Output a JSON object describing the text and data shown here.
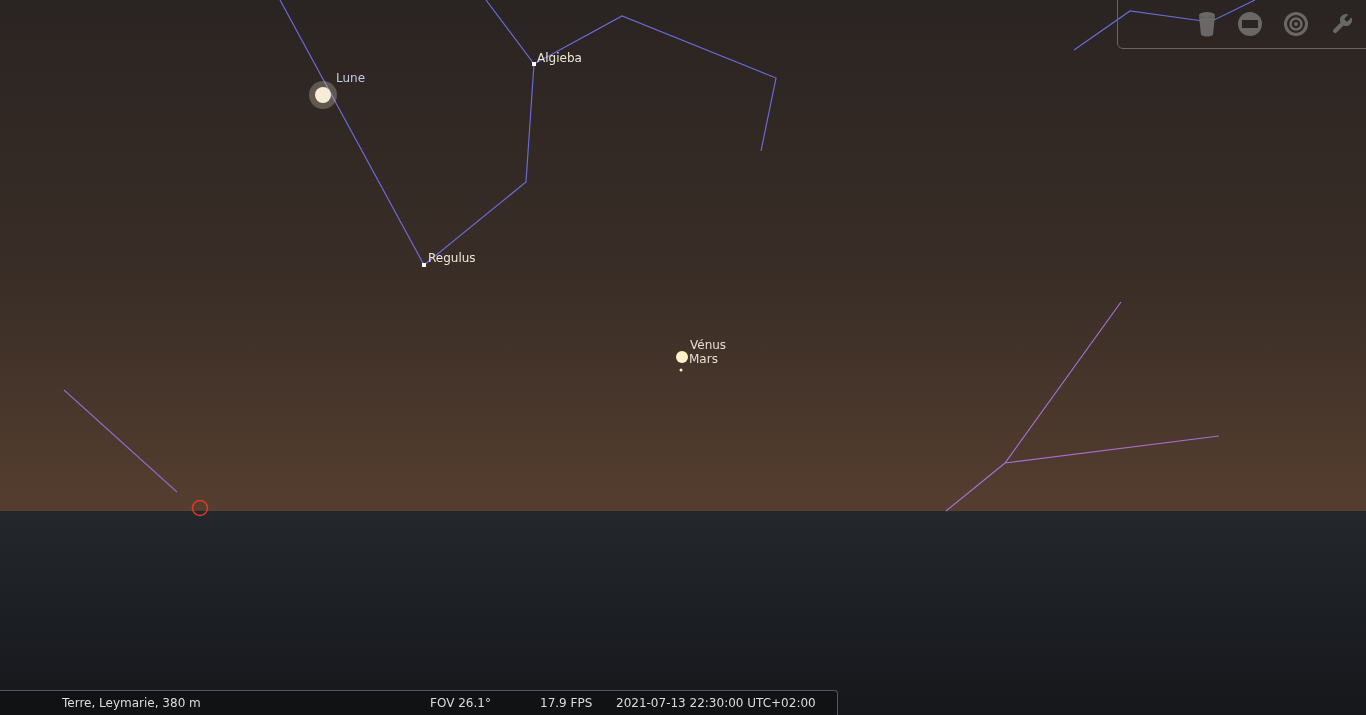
{
  "sky_labels": [
    {
      "label": "Lune",
      "kind": "moon"
    },
    {
      "label": "Algieba",
      "kind": "star"
    },
    {
      "label": "Regulus",
      "kind": "star"
    },
    {
      "label": "Vénus",
      "kind": "planet"
    },
    {
      "label": "Mars",
      "kind": "planet"
    }
  ],
  "status_bar": {
    "location": "Terre, Leymarie, 380 m",
    "fov": "FOV 26.1°",
    "fps": "17.9 FPS",
    "datetime": "2021-07-13 22:30:00 UTC+02:00"
  }
}
